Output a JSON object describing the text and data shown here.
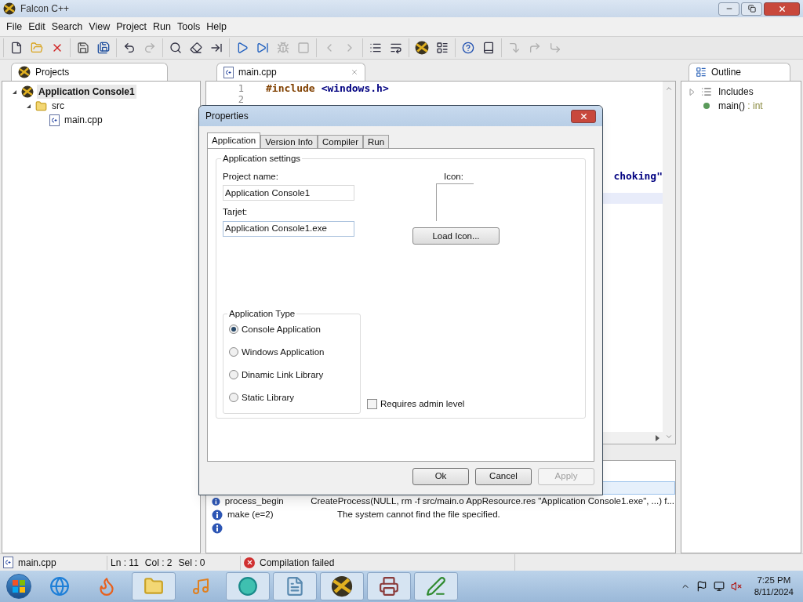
{
  "window": {
    "title": "Falcon C++"
  },
  "menu": [
    "File",
    "Edit",
    "Search",
    "View",
    "Project",
    "Run",
    "Tools",
    "Help"
  ],
  "toolbar": [
    [
      {
        "kind": "new",
        "disabled": false
      },
      {
        "kind": "open",
        "disabled": false
      },
      {
        "kind": "close",
        "disabled": false
      }
    ],
    [
      {
        "kind": "save",
        "disabled": false
      },
      {
        "kind": "save-all",
        "disabled": false
      }
    ],
    [
      {
        "kind": "undo",
        "disabled": false
      },
      {
        "kind": "redo",
        "disabled": true
      }
    ],
    [
      {
        "kind": "find",
        "disabled": false
      },
      {
        "kind": "clear",
        "disabled": false
      },
      {
        "kind": "goto",
        "disabled": false
      }
    ],
    [
      {
        "kind": "run",
        "disabled": false
      },
      {
        "kind": "step",
        "disabled": false
      },
      {
        "kind": "debug",
        "disabled": true
      },
      {
        "kind": "stop",
        "disabled": true
      }
    ],
    [
      {
        "kind": "back",
        "disabled": true
      },
      {
        "kind": "forward",
        "disabled": true
      }
    ],
    [
      {
        "kind": "list",
        "disabled": false
      },
      {
        "kind": "wrap",
        "disabled": false
      }
    ],
    [
      {
        "kind": "logo",
        "disabled": false
      },
      {
        "kind": "properties",
        "disabled": false
      }
    ],
    [
      {
        "kind": "help",
        "disabled": false
      },
      {
        "kind": "book",
        "disabled": false
      }
    ],
    [
      {
        "kind": "step-into",
        "disabled": true
      },
      {
        "kind": "step-over",
        "disabled": true
      },
      {
        "kind": "step-out",
        "disabled": true
      }
    ]
  ],
  "projects": {
    "tab": "Projects",
    "tree": [
      {
        "label": "Application Console1",
        "kind": "project",
        "selected": true,
        "expanded": true,
        "children": [
          {
            "label": "src",
            "kind": "folder",
            "selected": false,
            "expanded": true,
            "children": [
              {
                "label": "main.cpp",
                "kind": "file",
                "selected": false
              }
            ]
          }
        ]
      }
    ]
  },
  "editor": {
    "tab": "main.cpp",
    "lines": [
      {
        "number": "1",
        "directive": "#include",
        "header": "<windows.h>",
        "current": false
      },
      {
        "number": "2",
        "current": false
      },
      {
        "current": false
      },
      {
        "current": false
      },
      {
        "current": false
      },
      {
        "current": false
      },
      {
        "current": false
      },
      {
        "current": false
      },
      {
        "fragment": "choking\"",
        "current": false
      },
      {
        "current": false
      },
      {
        "current": true
      }
    ]
  },
  "output": {
    "rows": [
      {
        "selected": true
      },
      {
        "name": "process_begin",
        "message": "CreateProcess(NULL, rm -f src/main.o AppResource.res \"Application Console1.exe\", ...) f...",
        "selected": false
      },
      {
        "name": "make (e=2)",
        "message": "The system cannot find the file specified.",
        "selected": false
      },
      {
        "selected": false
      }
    ]
  },
  "outline": {
    "tab": "Outline",
    "items": [
      {
        "label": "Includes",
        "kind": "includes"
      },
      {
        "label": "main()",
        "type": ": int",
        "kind": "function"
      }
    ]
  },
  "status_bar": {
    "file": "main.cpp",
    "line": "Ln : 11",
    "col": "Col : 2",
    "sel": "Sel : 0",
    "message": "Compilation failed"
  },
  "dialog": {
    "title": "Properties",
    "tabs": [
      {
        "label": "Application",
        "selected": true
      },
      {
        "label": "Version Info",
        "selected": false
      },
      {
        "label": "Compiler",
        "selected": false
      },
      {
        "label": "Run",
        "selected": false
      }
    ],
    "group": "Application settings",
    "project_name_label": "Project name:",
    "project_name": "Application Console1",
    "target_label": "Tarjet:",
    "target": "Application Console1.exe",
    "icon_label": "Icon:",
    "load_icon": "Load Icon...",
    "type_group": "Application Type",
    "types": [
      {
        "label": "Console Application",
        "selected": true
      },
      {
        "label": "Windows Application",
        "selected": false
      },
      {
        "label": "Dinamic Link Library",
        "selected": false
      },
      {
        "label": "Static Library",
        "selected": false
      }
    ],
    "admin": {
      "label": "Requires admin level",
      "checked": false
    },
    "buttons": [
      {
        "label": "Ok",
        "disabled": false
      },
      {
        "label": "Cancel",
        "disabled": false
      },
      {
        "label": "Apply",
        "disabled": true
      }
    ]
  },
  "taskbar": {
    "time": "7:25 PM",
    "date": "8/11/2024"
  }
}
